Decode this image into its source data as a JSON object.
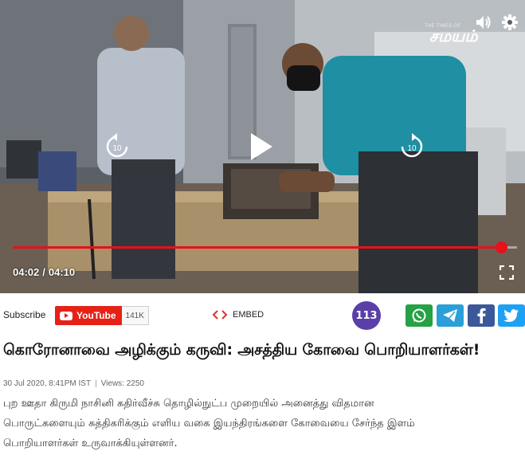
{
  "player": {
    "watermark_small": "THE TIMES OF",
    "watermark_big": "சமயம்",
    "current_time": "04:02",
    "time_separator": "/",
    "duration": "04:10",
    "progress_fraction": 0.968,
    "rewind_seconds": "10",
    "forward_seconds": "10",
    "accent_color": "#e8101b"
  },
  "actions": {
    "subscribe_label": "Subscribe",
    "youtube_label": "YouTube",
    "youtube_count": "141K",
    "embed_label": "EMBED",
    "comments_count": "113",
    "share_icons": [
      "whatsapp-icon",
      "telegram-icon",
      "facebook-icon",
      "twitter-icon"
    ],
    "share_colors": [
      "#25a244",
      "#2a9fd8",
      "#3b5998",
      "#1da1f2"
    ]
  },
  "article": {
    "headline": "கொரோனாவை அழிக்கும் கருவி: அசத்திய கோவை பொறியாளர்கள்!",
    "date": "30 Jul 2020, 8:41PM IST",
    "views": "Views: 2250",
    "body_lines": [
      "புற ஊதா கிருமி நாசினி கதிர்வீச்சு தொழில்நுட்ப முறையில் அனைத்து விதமான",
      "பொருட்களையும் சுத்திகரிக்கும் எளிய வகை இயந்திரங்களை கோவையை சேர்ந்த இளம்",
      "பொறியாளர்கள் உருவாக்கியுள்ளனர்."
    ]
  }
}
